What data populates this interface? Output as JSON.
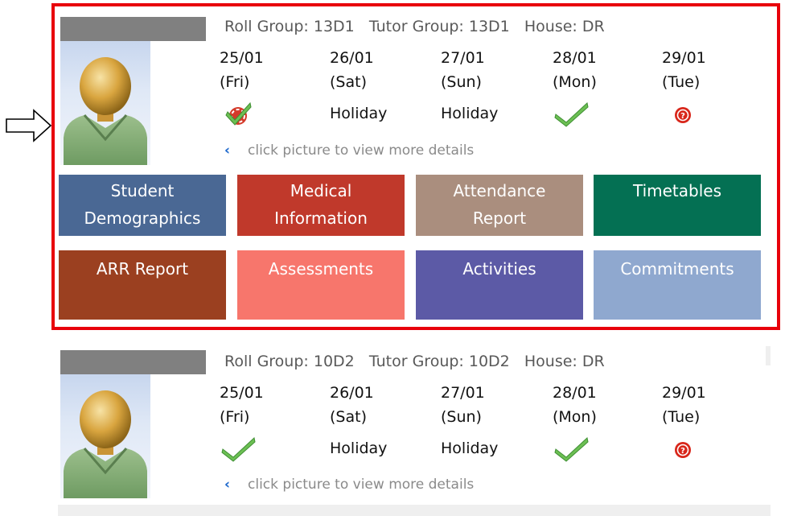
{
  "students": [
    {
      "roll_group": "Roll Group: 13D1",
      "tutor_group": "Tutor Group: 13D1",
      "house": "House: DR",
      "days": [
        {
          "date": "25/01",
          "dow": "(Fri)",
          "status": "partial-check-icon"
        },
        {
          "date": "26/01",
          "dow": "(Sat)",
          "status": "Holiday"
        },
        {
          "date": "27/01",
          "dow": "(Sun)",
          "status": "Holiday"
        },
        {
          "date": "28/01",
          "dow": "(Mon)",
          "status": "check-icon"
        },
        {
          "date": "29/01",
          "dow": "(Tue)",
          "status": "question-icon"
        }
      ],
      "hint": "click picture to view more details",
      "tiles": [
        {
          "label": "Student\nDemographics",
          "color": "#4a6894"
        },
        {
          "label": "Medical\nInformation",
          "color": "#c0392b"
        },
        {
          "label": "Attendance\nReport",
          "color": "#aa8e7e"
        },
        {
          "label": "Timetables",
          "color": "#047053"
        },
        {
          "label": "ARR Report",
          "color": "#9b4020"
        },
        {
          "label": "Assessments",
          "color": "#f7766c"
        },
        {
          "label": "Activities",
          "color": "#5c5aa6"
        },
        {
          "label": "Commitments",
          "color": "#8fa8cf"
        }
      ]
    },
    {
      "roll_group": "Roll Group: 10D2",
      "tutor_group": "Tutor Group: 10D2",
      "house": "House: DR",
      "days": [
        {
          "date": "25/01",
          "dow": "(Fri)",
          "status": "check-icon"
        },
        {
          "date": "26/01",
          "dow": "(Sat)",
          "status": "Holiday"
        },
        {
          "date": "27/01",
          "dow": "(Sun)",
          "status": "Holiday"
        },
        {
          "date": "28/01",
          "dow": "(Mon)",
          "status": "check-icon"
        },
        {
          "date": "29/01",
          "dow": "(Tue)",
          "status": "question-icon"
        }
      ],
      "hint": "click picture to view more details"
    }
  ],
  "hint_chevron": "‹",
  "colors": {
    "highlight": "#e8000b",
    "namebar": "#808080",
    "hint_text": "#8a8a8a",
    "chevron": "#1a66cc"
  }
}
